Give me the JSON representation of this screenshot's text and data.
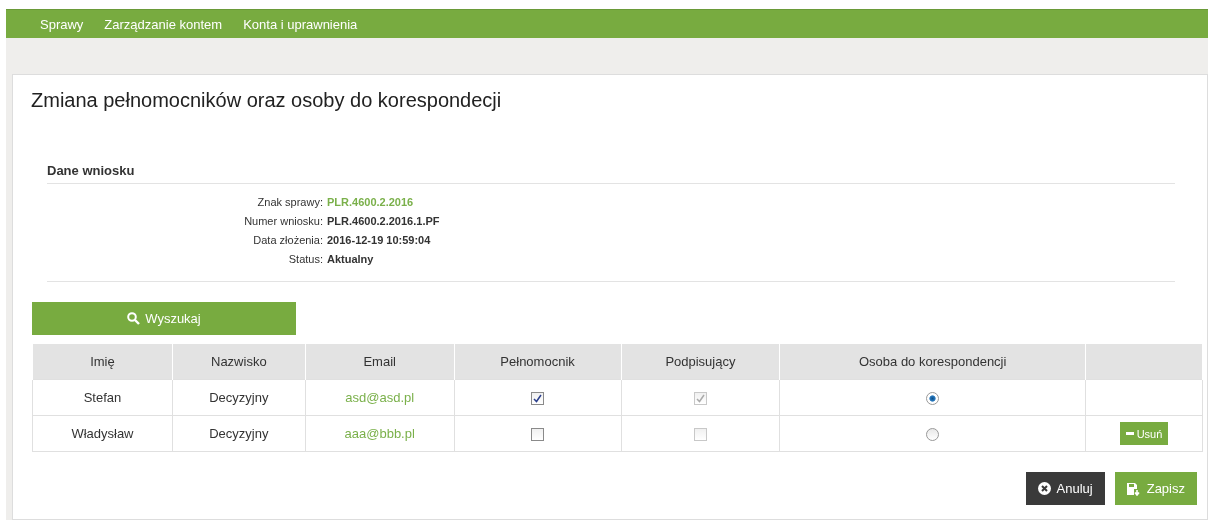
{
  "nav": {
    "items": [
      {
        "label": "Sprawy",
        "selected": false
      },
      {
        "label": "Zarządzanie kontem",
        "selected": false
      },
      {
        "label": "Konta i uprawnienia",
        "selected": false
      }
    ]
  },
  "title": "Zmiana pełnomocników oraz osoby do korespondecji",
  "section": {
    "heading": "Dane wniosku",
    "fields": [
      {
        "label": "Znak sprawy:",
        "value": "PLR.4600.2.2016",
        "kind": "link"
      },
      {
        "label": "Numer wniosku:",
        "value": "PLR.4600.2.2016.1.PF",
        "kind": "text"
      },
      {
        "label": "Data złożenia:",
        "value": "2016-12-19 10:59:04",
        "kind": "text"
      },
      {
        "label": "Status:",
        "value": "Aktualny",
        "kind": "text"
      }
    ]
  },
  "search_button": "Wyszukaj",
  "table": {
    "columns": [
      "Imię",
      "Nazwisko",
      "Email",
      "Pełnomocnik",
      "Podpisujący",
      "Osoba do korespondencji"
    ],
    "rows": [
      {
        "first_name": "Stefan",
        "last_name": "Decyzyjny",
        "email": "asd@asd.pl",
        "pelnomocnik": {
          "checked": true
        },
        "podpisujacy": {
          "checked": true,
          "disabled": true
        },
        "korespondencja": {
          "selected": true
        }
      },
      {
        "first_name": "Władysław",
        "last_name": "Decyzyjny",
        "email": "aaa@bbb.pl",
        "pelnomocnik": {
          "checked": false
        },
        "podpisujacy": {
          "checked": false,
          "disabled": true
        },
        "korespondencja": {
          "selected": false
        },
        "remove_button": "Usuń"
      }
    ]
  },
  "buttons": [
    {
      "kind": "cancel",
      "label": "Anuluj"
    },
    {
      "kind": "save",
      "label": "Zapisz"
    }
  ]
}
